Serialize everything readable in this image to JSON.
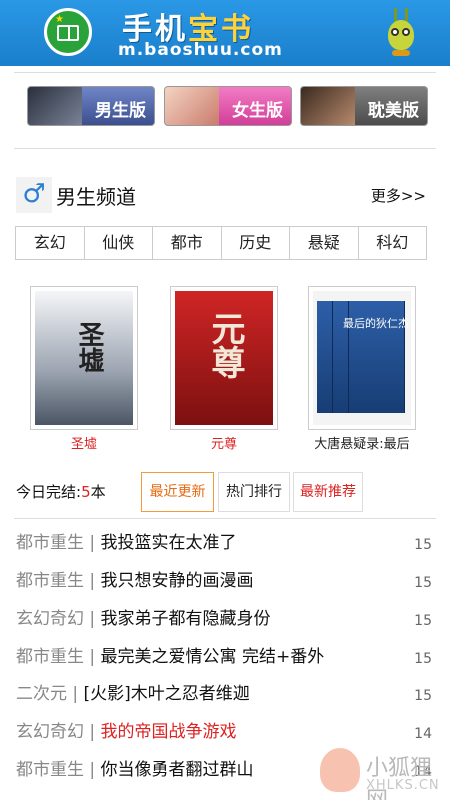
{
  "header": {
    "title_part1": "手机",
    "title_part2": "宝书",
    "url": "m.baoshuu.com"
  },
  "versions": [
    {
      "label": "男生版"
    },
    {
      "label": "女生版"
    },
    {
      "label": "耽美版"
    }
  ],
  "channel": {
    "icon_glyph": "♂",
    "title": "男生频道",
    "more": "更多>>"
  },
  "categories": [
    "玄幻",
    "仙侠",
    "都市",
    "历史",
    "悬疑",
    "科幻"
  ],
  "books": [
    {
      "title": "圣墟",
      "cover_text": "圣墟"
    },
    {
      "title": "元尊",
      "cover_text": "元尊"
    },
    {
      "title": "大唐悬疑录:最后",
      "cover_text": "最后的狄仁杰"
    }
  ],
  "today": {
    "prefix": "今日完结:",
    "count": "5",
    "suffix": "本"
  },
  "tabs": {
    "recent": "最近更新",
    "hot": "热门排行",
    "new": "最新推荐"
  },
  "list": [
    {
      "genre": "都市重生",
      "sep": " | ",
      "name": "我投篮实在太准了",
      "date": "15"
    },
    {
      "genre": "都市重生",
      "sep": " | ",
      "name": "我只想安静的画漫画",
      "date": "15"
    },
    {
      "genre": "玄幻奇幻",
      "sep": " | ",
      "name": "我家弟子都有隐藏身份",
      "date": "15"
    },
    {
      "genre": "都市重生",
      "sep": " | ",
      "name": "最完美之爱情公寓 完结+番外",
      "date": "15"
    },
    {
      "genre": "二次元",
      "sep": " | ",
      "name": "[火影]木叶之忍者维迦",
      "date": "15"
    },
    {
      "genre": "玄幻奇幻",
      "sep": " | ",
      "name": "我的帝国战争游戏",
      "date": "14"
    },
    {
      "genre": "都市重生",
      "sep": " | ",
      "name": "你当像勇者翻过群山",
      "date": "14"
    }
  ],
  "watermark": {
    "cn": "小狐狸网",
    "en": "XHLKS.CN"
  },
  "colors": {
    "header_blue": "#1f8ad6",
    "accent_red": "#dd2222",
    "accent_orange": "#e46b12"
  }
}
